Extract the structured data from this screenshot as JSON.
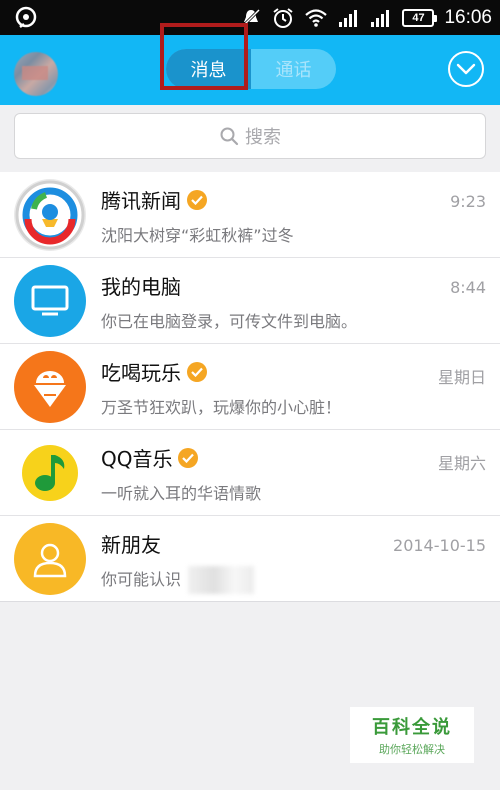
{
  "status_bar": {
    "battery": "47",
    "time": "16:06",
    "icons": [
      "app-notification-icon",
      "mute-icon",
      "alarm-icon",
      "wifi-icon",
      "signal-icon",
      "signal-icon",
      "battery-icon"
    ]
  },
  "header": {
    "tabs": [
      {
        "label": "消息",
        "active": true
      },
      {
        "label": "通话",
        "active": false
      }
    ],
    "accent": "#12b7f5",
    "highlight_color": "#b01c1c"
  },
  "search": {
    "placeholder": "搜索"
  },
  "conversations": [
    {
      "name": "腾讯新闻",
      "verified": true,
      "preview": "沈阳大树穿“彩虹秋裤”过冬",
      "time": "9:23"
    },
    {
      "name": "我的电脑",
      "verified": false,
      "preview": "你已在电脑登录，可传文件到电脑。",
      "time": "8:44"
    },
    {
      "name": "吃喝玩乐",
      "verified": true,
      "preview": "万圣节狂欢趴，玩爆你的小心脏！",
      "time": "星期日"
    },
    {
      "name": "QQ音乐",
      "verified": true,
      "preview": "一听就入耳的华语情歌",
      "time": "星期六"
    },
    {
      "name": "新朋友",
      "verified": false,
      "preview": "你可能认识",
      "time": "2014-10-15"
    }
  ],
  "watermark": {
    "title": "百科全说",
    "subtitle": "助你轻松解决"
  }
}
